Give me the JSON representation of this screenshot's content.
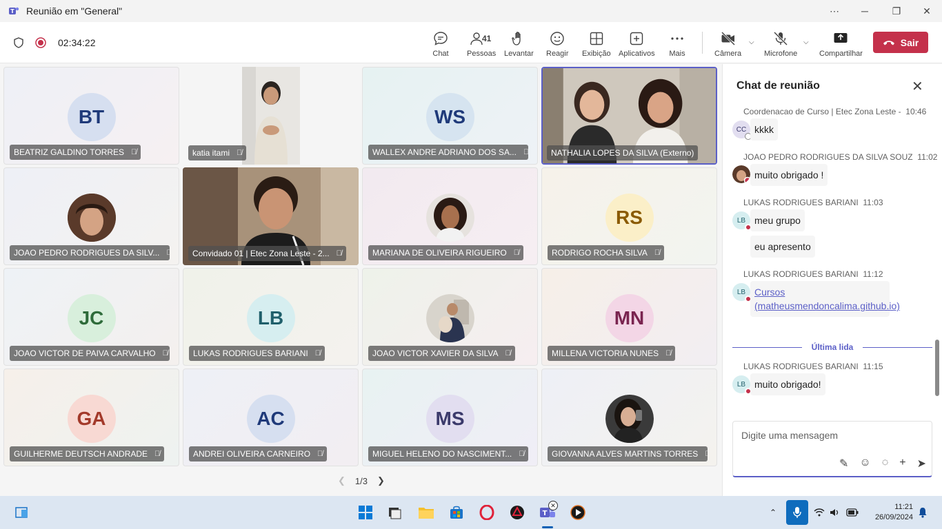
{
  "window": {
    "title": "Reunião em \"General\"",
    "controls": [
      "more",
      "restore",
      "close"
    ]
  },
  "toolbar": {
    "timer": "02:34:22",
    "chat_label": "Chat",
    "people_label": "Pessoas",
    "people_count": "41",
    "raise_label": "Levantar",
    "react_label": "Reagir",
    "view_label": "Exibição",
    "apps_label": "Aplicativos",
    "more_label": "Mais",
    "camera_label": "Câmera",
    "mic_label": "Microfone",
    "share_label": "Compartilhar",
    "leave_label": "Sair"
  },
  "participants": [
    {
      "name": "BEATRIZ GALDINO TORRES",
      "initials": "BT",
      "color": "#1f3a7a",
      "circle": "#d6dff0"
    },
    {
      "name": "katia itami",
      "initials": "",
      "video": true
    },
    {
      "name": "WALLEX ANDRE ADRIANO DOS SA...",
      "initials": "WS",
      "color": "#1f3a7a",
      "circle": "#d6e4f0"
    },
    {
      "name": "NATHALIA LOPES DA SILVA (Externo)",
      "initials": "",
      "video": true
    },
    {
      "name": "JOAO PEDRO RODRIGUES DA SILV...",
      "initials": "",
      "photo": true
    },
    {
      "name": "Convidado 01 | Etec Zona Leste - 2...",
      "initials": "",
      "video": true
    },
    {
      "name": "MARIANA DE OLIVEIRA RIGUEIRO",
      "initials": "",
      "photo": true
    },
    {
      "name": "RODRIGO ROCHA SILVA",
      "initials": "RS",
      "color": "#8a5a00",
      "circle": "#fbefc8"
    },
    {
      "name": "JOAO VICTOR DE PAIVA CARVALHO",
      "initials": "JC",
      "color": "#2e6b3a",
      "circle": "#d8efdc"
    },
    {
      "name": "LUKAS RODRIGUES BARIANI",
      "initials": "LB",
      "color": "#1f5f6b",
      "circle": "#d6eef0"
    },
    {
      "name": "JOAO VICTOR XAVIER DA SILVA",
      "initials": "",
      "photo": true
    },
    {
      "name": "MILLENA VICTORIA NUNES",
      "initials": "MN",
      "color": "#7a2450",
      "circle": "#f3d6e6"
    },
    {
      "name": "GUILHERME DEUTSCH ANDRADE",
      "initials": "GA",
      "color": "#a33a2b",
      "circle": "#f8d9d3"
    },
    {
      "name": "ANDREI OLIVEIRA CARNEIRO",
      "initials": "AC",
      "color": "#1f3a7a",
      "circle": "#d6dff0"
    },
    {
      "name": "MIGUEL HELENO DO NASCIMENT...",
      "initials": "MS",
      "color": "#3b3a6b",
      "circle": "#e2def0"
    },
    {
      "name": "GIOVANNA ALVES MARTINS TORRES",
      "initials": "",
      "photo": true
    }
  ],
  "pager": {
    "text": "1/3"
  },
  "chat": {
    "title": "Chat de reunião",
    "messages": [
      {
        "author": "Coordenacao de Curso | Etec Zona Leste -",
        "time": "10:46",
        "initials": "CC",
        "lines": [
          "kkkk"
        ]
      },
      {
        "author": "JOAO PEDRO RODRIGUES DA SILVA SOUZ",
        "time": "11:02",
        "initials": "",
        "lines": [
          "muito obrigado !"
        ]
      },
      {
        "author": "LUKAS RODRIGUES BARIANI",
        "time": "11:03",
        "initials": "LB",
        "lines": [
          "meu grupo",
          "eu apresento"
        ]
      },
      {
        "author": "LUKAS RODRIGUES BARIANI",
        "time": "11:12",
        "initials": "LB",
        "link": "Cursos (matheusmendoncalima.github.io)"
      },
      {
        "author": "LUKAS RODRIGUES BARIANI",
        "time": "11:15",
        "initials": "LB",
        "lines": [
          "muito obrigado!"
        ]
      }
    ],
    "last_read": "Última lida",
    "compose_placeholder": "Digite uma mensagem"
  },
  "taskbar": {
    "time": "11:21",
    "date": "26/09/2024"
  },
  "colors": {
    "accent": "#5b5fc7",
    "leave": "#c4314b",
    "mic_active": "#0f6cbd"
  }
}
